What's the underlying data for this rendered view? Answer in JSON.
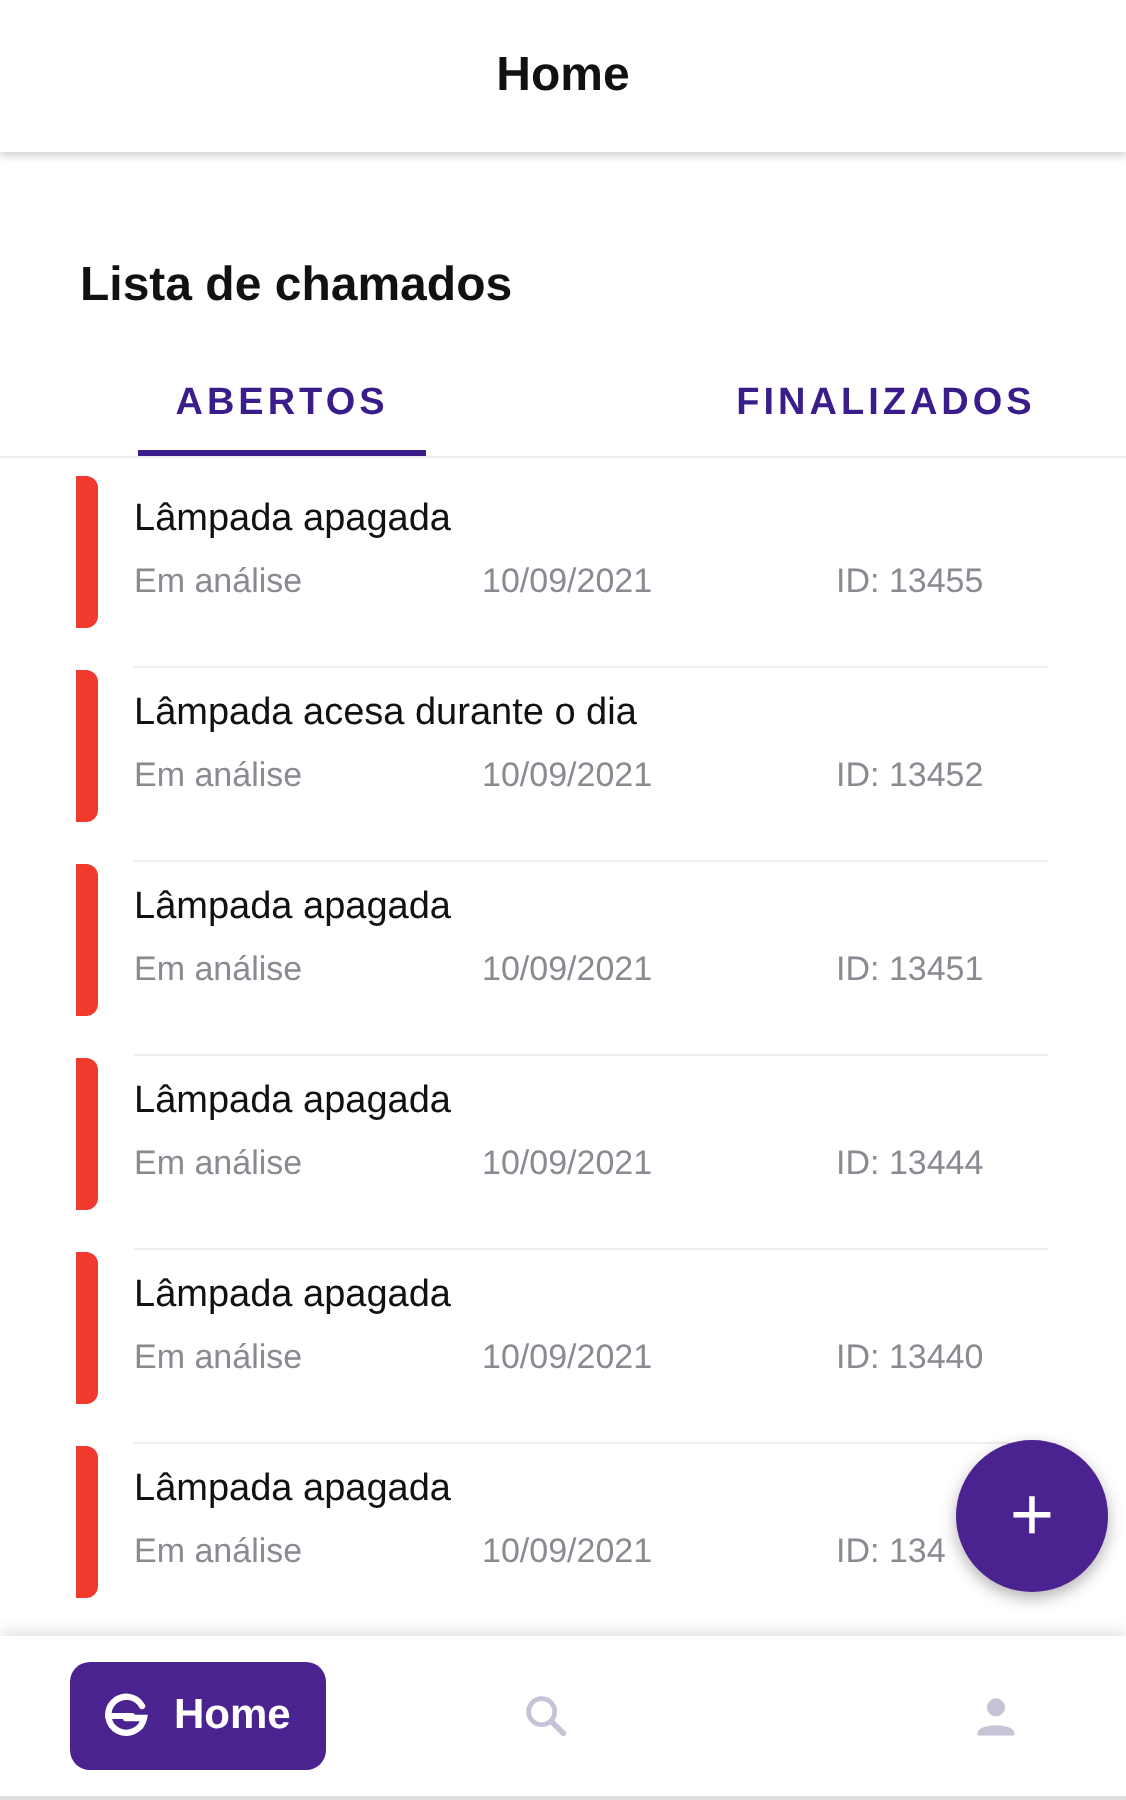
{
  "header": {
    "title": "Home"
  },
  "section_title": "Lista de chamados",
  "tabs": [
    {
      "label": "ABERTOS",
      "selected": true
    },
    {
      "label": "FINALIZADOS",
      "selected": false
    }
  ],
  "tickets": [
    {
      "title": "Lâmpada apagada",
      "status": "Em análise",
      "date": "10/09/2021",
      "id": "ID: 13455",
      "color": "#f03a2e"
    },
    {
      "title": "Lâmpada acesa durante o dia",
      "status": "Em análise",
      "date": "10/09/2021",
      "id": "ID: 13452",
      "color": "#f03a2e"
    },
    {
      "title": "Lâmpada apagada",
      "status": "Em análise",
      "date": "10/09/2021",
      "id": "ID: 13451",
      "color": "#f03a2e"
    },
    {
      "title": "Lâmpada apagada",
      "status": "Em análise",
      "date": "10/09/2021",
      "id": "ID: 13444",
      "color": "#f03a2e"
    },
    {
      "title": "Lâmpada apagada",
      "status": "Em análise",
      "date": "10/09/2021",
      "id": "ID: 13440",
      "color": "#f03a2e"
    },
    {
      "title": "Lâmpada apagada",
      "status": "Em análise",
      "date": "10/09/2021",
      "id": "ID: 134",
      "color": "#f03a2e"
    }
  ],
  "fab": {
    "label": "+"
  },
  "bottom_nav": [
    {
      "kind": "home",
      "label": "Home",
      "selected": true
    },
    {
      "kind": "search",
      "selected": false
    },
    {
      "kind": "profile",
      "selected": false
    }
  ]
}
